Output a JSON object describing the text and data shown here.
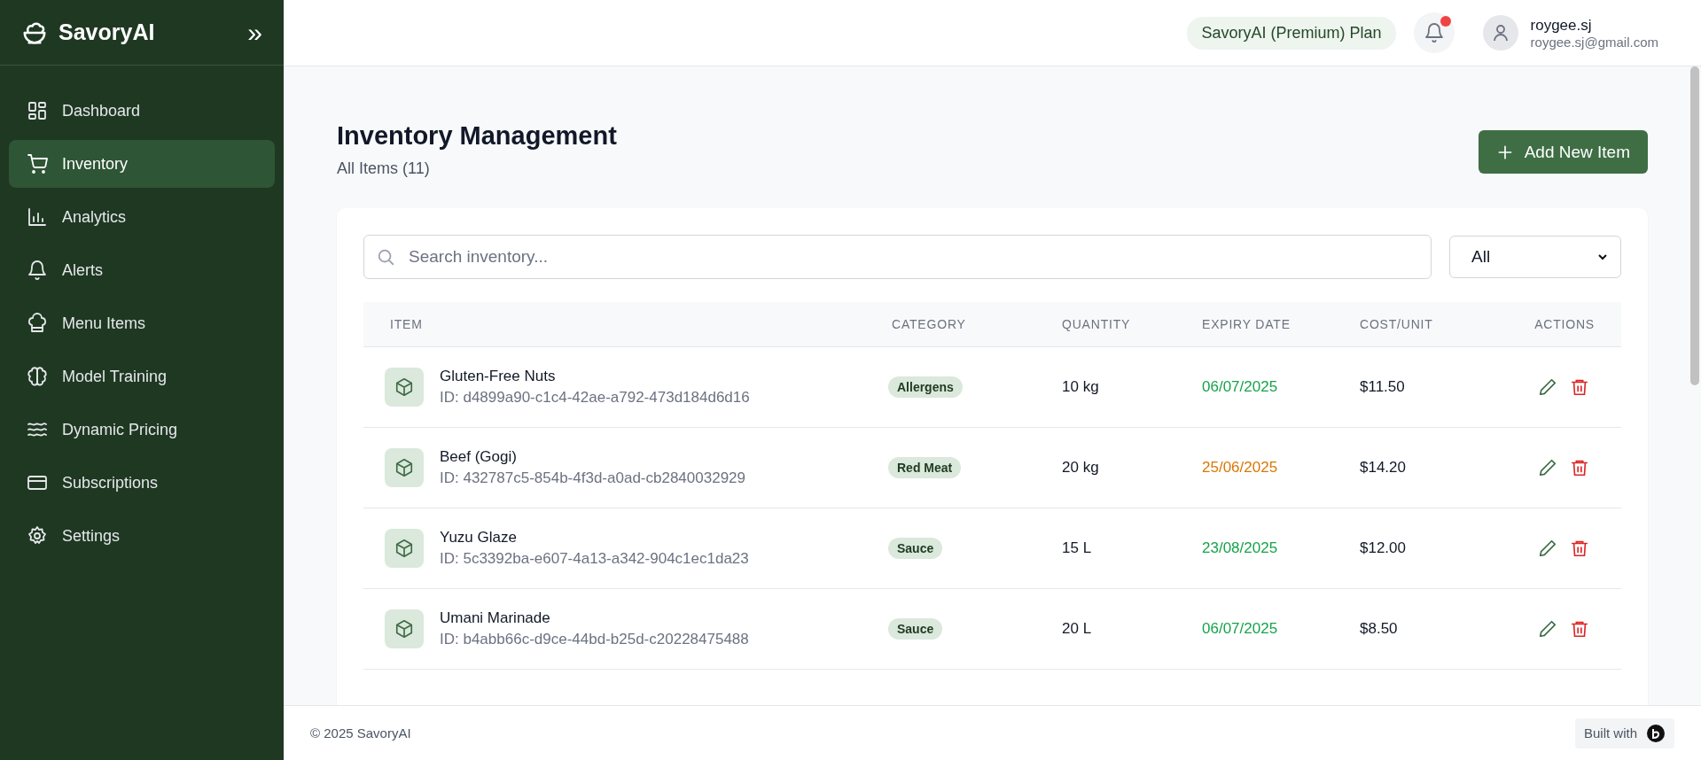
{
  "sidebar": {
    "brand": "SavoryAI",
    "collapse_icon": "»",
    "items": [
      {
        "label": "Dashboard",
        "selected": false
      },
      {
        "label": "Inventory",
        "selected": true
      },
      {
        "label": "Analytics",
        "selected": false
      },
      {
        "label": "Alerts",
        "selected": false
      },
      {
        "label": "Menu Items",
        "selected": false
      },
      {
        "label": "Model Training",
        "selected": false
      },
      {
        "label": "Dynamic Pricing",
        "selected": false
      },
      {
        "label": "Subscriptions",
        "selected": false
      },
      {
        "label": "Settings",
        "selected": false
      }
    ]
  },
  "header": {
    "plan": "SavoryAI (Premium) Plan",
    "notification_unread": true,
    "user_name": "roygee.sj",
    "user_email": "roygee.sj@gmail.com"
  },
  "page": {
    "title": "Inventory Management",
    "subtitle": "All Items (11)",
    "add_button": "Add New Item"
  },
  "search": {
    "placeholder": "Search inventory..."
  },
  "filter": {
    "value": "All"
  },
  "table": {
    "columns": [
      "ITEM",
      "CATEGORY",
      "QUANTITY",
      "EXPIRY DATE",
      "COST/UNIT",
      "ACTIONS"
    ],
    "rows": [
      {
        "name": "Gluten-Free Nuts",
        "id": "ID: d4899a90-c1c4-42ae-a792-473d184d6d16",
        "category": "Allergens",
        "quantity": "10 kg",
        "expiry": "06/07/2025",
        "color": "#16a34a",
        "cost": "$11.50"
      },
      {
        "name": "Beef (Gogi)",
        "id": "ID: 432787c5-854b-4f3d-a0ad-cb2840032929",
        "category": "Red Meat",
        "quantity": "20 kg",
        "expiry": "25/06/2025",
        "color": "#d97706",
        "cost": "$14.20"
      },
      {
        "name": "Yuzu Glaze",
        "id": "ID: 5c3392ba-e607-4a13-a342-904c1ec1da23",
        "category": "Sauce",
        "quantity": "15 L",
        "expiry": "23/08/2025",
        "color": "#16a34a",
        "cost": "$12.00"
      },
      {
        "name": "Umani Marinade",
        "id": "ID: b4abb66c-d9ce-44bd-b25d-c20228475488",
        "category": "Sauce",
        "quantity": "20 L",
        "expiry": "06/07/2025",
        "color": "#16a34a",
        "cost": "$8.50"
      }
    ]
  },
  "footer": {
    "copyright": "© 2025 SavoryAI",
    "built_with": "Built with"
  }
}
